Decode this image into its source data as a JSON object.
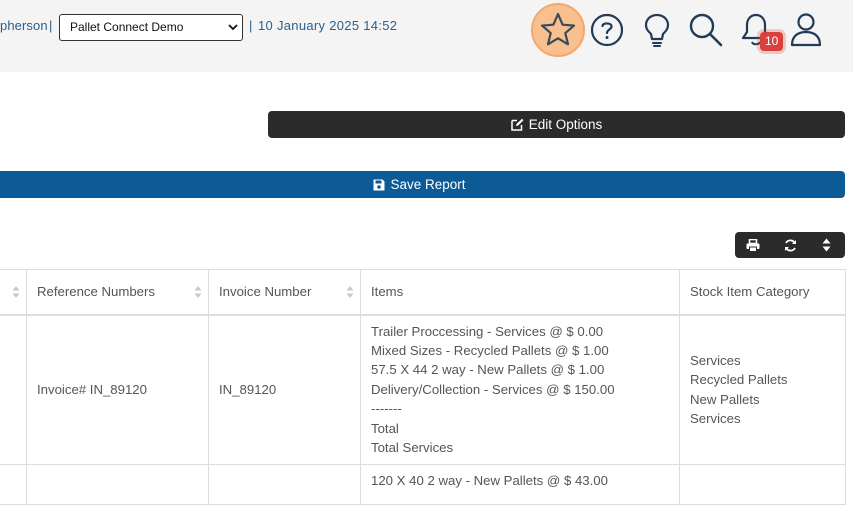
{
  "header": {
    "user_name_fragment": "pherson",
    "company_select": "Pallet Connect Demo",
    "separator": "|",
    "datetime": "10 January 2025 14:52",
    "notification_count": "10"
  },
  "buttons": {
    "edit_options": "Edit Options",
    "save_report": "Save Report"
  },
  "table": {
    "headers": [
      "",
      "Reference Numbers",
      "Invoice Number",
      "Items",
      "Stock Item Category"
    ],
    "rows": [
      {
        "reference": "Invoice# IN_89120",
        "invoice": "IN_89120",
        "items": [
          "Trailer Proccessing - Services @ $ 0.00",
          "Mixed Sizes - Recycled Pallets @ $ 1.00",
          "57.5 X 44 2 way - New Pallets @ $ 1.00",
          "Delivery/Collection - Services @ $ 150.00",
          "-------",
          "Total",
          "Total Services"
        ],
        "categories": [
          "Services",
          "Recycled Pallets",
          "New Pallets",
          "Services"
        ]
      },
      {
        "reference": "",
        "invoice": "",
        "items": [
          "120 X 40 2 way - New Pallets @ $ 43.00"
        ],
        "categories": []
      }
    ]
  }
}
